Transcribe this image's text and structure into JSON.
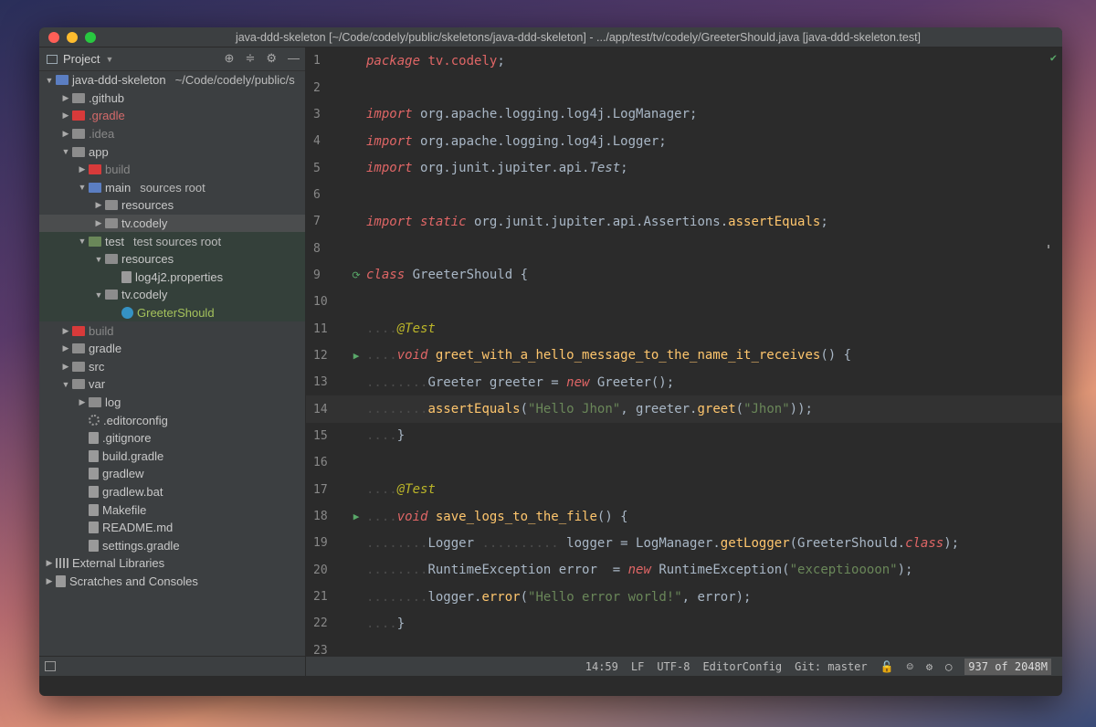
{
  "window": {
    "title": "java-ddd-skeleton [~/Code/codely/public/skeletons/java-ddd-skeleton] - .../app/test/tv/codely/GreeterShould.java [java-ddd-skeleton.test]"
  },
  "sidebar": {
    "header_label": "Project",
    "tree": [
      {
        "label": "java-ddd-skeleton",
        "sub": "~/Code/codely/public/s",
        "arrow": "▼",
        "icon": "folder-blue",
        "indent": 0
      },
      {
        "label": ".github",
        "arrow": "▶",
        "icon": "folder",
        "indent": 1
      },
      {
        "label": ".gradle",
        "arrow": "▶",
        "icon": "folder-red",
        "indent": 1,
        "style": "red"
      },
      {
        "label": ".idea",
        "arrow": "▶",
        "icon": "folder",
        "indent": 1,
        "style": "dim"
      },
      {
        "label": "app",
        "arrow": "▼",
        "icon": "folder",
        "indent": 1
      },
      {
        "label": "build",
        "arrow": "▶",
        "icon": "folder-red",
        "indent": 2,
        "style": "dim"
      },
      {
        "label": "main",
        "sub": "sources root",
        "arrow": "▼",
        "icon": "folder-blue",
        "indent": 2
      },
      {
        "label": "resources",
        "arrow": "▶",
        "icon": "folder",
        "indent": 3
      },
      {
        "label": "tv.codely",
        "arrow": "▶",
        "icon": "folder",
        "indent": 3,
        "row": "sel"
      },
      {
        "label": "test",
        "sub": "test sources root",
        "arrow": "▼",
        "icon": "folder-green",
        "indent": 2,
        "row": "testbg"
      },
      {
        "label": "resources",
        "arrow": "▼",
        "icon": "folder",
        "indent": 3,
        "row": "testbg"
      },
      {
        "label": "log4j2.properties",
        "arrow": "",
        "icon": "file",
        "indent": 4,
        "row": "testbg"
      },
      {
        "label": "tv.codely",
        "arrow": "▼",
        "icon": "folder",
        "indent": 3,
        "row": "testbg"
      },
      {
        "label": "GreeterShould",
        "arrow": "",
        "icon": "class",
        "indent": 4,
        "row": "active"
      },
      {
        "label": "build",
        "arrow": "▶",
        "icon": "folder-red",
        "indent": 1,
        "style": "dim"
      },
      {
        "label": "gradle",
        "arrow": "▶",
        "icon": "folder",
        "indent": 1
      },
      {
        "label": "src",
        "arrow": "▶",
        "icon": "folder",
        "indent": 1
      },
      {
        "label": "var",
        "arrow": "▼",
        "icon": "folder",
        "indent": 1
      },
      {
        "label": "log",
        "arrow": "▶",
        "icon": "folder",
        "indent": 2
      },
      {
        "label": ".editorconfig",
        "arrow": "",
        "icon": "gear",
        "indent": 2
      },
      {
        "label": ".gitignore",
        "arrow": "",
        "icon": "file",
        "indent": 2
      },
      {
        "label": "build.gradle",
        "arrow": "",
        "icon": "file",
        "indent": 2
      },
      {
        "label": "gradlew",
        "arrow": "",
        "icon": "file",
        "indent": 2
      },
      {
        "label": "gradlew.bat",
        "arrow": "",
        "icon": "file",
        "indent": 2
      },
      {
        "label": "Makefile",
        "arrow": "",
        "icon": "file",
        "indent": 2
      },
      {
        "label": "README.md",
        "arrow": "",
        "icon": "file",
        "indent": 2
      },
      {
        "label": "settings.gradle",
        "arrow": "",
        "icon": "file",
        "indent": 2
      },
      {
        "label": "External Libraries",
        "arrow": "▶",
        "icon": "lib",
        "indent": 0
      },
      {
        "label": "Scratches and Consoles",
        "arrow": "▶",
        "icon": "file",
        "indent": 0
      }
    ]
  },
  "editor": {
    "lines": [
      {
        "n": "1",
        "html": "<span class='kwr'>package</span> <span class='kwr' style='font-style:normal'>tv.codely</span>;"
      },
      {
        "n": "2",
        "html": ""
      },
      {
        "n": "3",
        "html": "<span class='kwr'>import</span> org.apache.logging.log4j.LogManager;"
      },
      {
        "n": "4",
        "html": "<span class='kwr'>import</span> org.apache.logging.log4j.Logger;"
      },
      {
        "n": "5",
        "html": "<span class='kwr'>import</span> org.junit.jupiter.api.<span class='ital'>Test</span>;"
      },
      {
        "n": "6",
        "html": ""
      },
      {
        "n": "7",
        "html": "<span class='kwr'>import static</span> org.junit.jupiter.api.Assertions.<span class='fn'>assertEquals</span>;"
      },
      {
        "n": "8",
        "html": ""
      },
      {
        "n": "9",
        "html": "<span class='kwr'>class</span> GreeterShould {",
        "marker": "⟳"
      },
      {
        "n": "10",
        "html": ""
      },
      {
        "n": "11",
        "html": "<span class='dots'>....</span><span class='ann'>@Test</span>"
      },
      {
        "n": "12",
        "html": "<span class='dots'>....</span><span class='kwr'>void</span> <span class='fn'>greet_with_a_hello_message_to_the_name_it_receives</span>() {",
        "marker": "▶"
      },
      {
        "n": "13",
        "html": "<span class='dots'>........</span>Greeter greeter = <span class='kwr'>new</span> Greeter();"
      },
      {
        "n": "14",
        "html": "<span class='dots'>........</span><span class='fn'>assertEquals</span>(<span class='str'>\"Hello Jhon\"</span>, greeter.<span class='fn'>greet</span>(<span class='str'>\"Jhon\"</span>));",
        "hl": true
      },
      {
        "n": "15",
        "html": "<span class='dots'>....</span>}"
      },
      {
        "n": "16",
        "html": ""
      },
      {
        "n": "17",
        "html": "<span class='dots'>....</span><span class='ann'>@Test</span>"
      },
      {
        "n": "18",
        "html": "<span class='dots'>....</span><span class='kwr'>void</span> <span class='fn'>save_logs_to_the_file</span>() {",
        "marker": "▶"
      },
      {
        "n": "19",
        "html": "<span class='dots'>........</span>Logger <span class='dots'>..........</span> logger = LogManager.<span class='fn'>getLogger</span>(GreeterShould.<span class='kwr'>class</span>);"
      },
      {
        "n": "20",
        "html": "<span class='dots'>........</span>RuntimeException error  = <span class='kwr'>new</span> RuntimeException(<span class='str'>\"exceptioooon\"</span>);"
      },
      {
        "n": "21",
        "html": "<span class='dots'>........</span>logger.<span class='fn'>error</span>(<span class='str'>\"Hello error world!\"</span>, error);"
      },
      {
        "n": "22",
        "html": "<span class='dots'>....</span>}"
      },
      {
        "n": "23",
        "html": ""
      }
    ]
  },
  "status": {
    "position": "14:59",
    "line_sep": "LF",
    "encoding": "UTF-8",
    "editorconfig": "EditorConfig",
    "git": "Git: master",
    "memory": "937 of 2048M"
  }
}
